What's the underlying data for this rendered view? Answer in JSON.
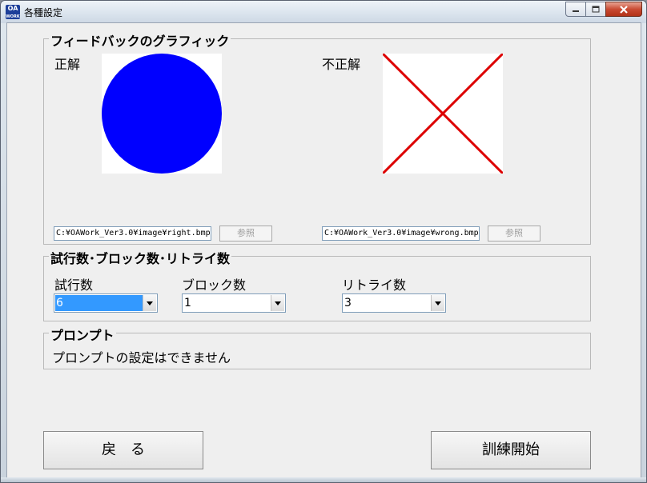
{
  "window": {
    "title": "各種設定",
    "app_icon_text": "OA",
    "app_icon_subtext": "WORK",
    "controls": [
      "minimize-icon",
      "maximize-icon",
      "close-icon"
    ]
  },
  "feedback": {
    "group_title": "フィードバックのグラフィック",
    "correct": {
      "label": "正解",
      "path": "C:¥OAWork_Ver3.0¥image¥right.bmp",
      "browse_label": "参照",
      "graphic": "blue-circle",
      "color": "#0000ff"
    },
    "wrong": {
      "label": "不正解",
      "path": "C:¥OAWork_Ver3.0¥image¥wrong.bmp",
      "browse_label": "参照",
      "graphic": "red-cross",
      "color": "#dd0000"
    }
  },
  "counts": {
    "group_title": "試行数･ブロック数･リトライ数",
    "trials": {
      "label": "試行数",
      "value": "6"
    },
    "blocks": {
      "label": "ブロック数",
      "value": "1"
    },
    "retries": {
      "label": "リトライ数",
      "value": "3"
    }
  },
  "prompt": {
    "group_title": "プロンプト",
    "message": "プロンプトの設定はできません"
  },
  "buttons": {
    "back_label": "戻　る",
    "start_label": "訓練開始"
  }
}
